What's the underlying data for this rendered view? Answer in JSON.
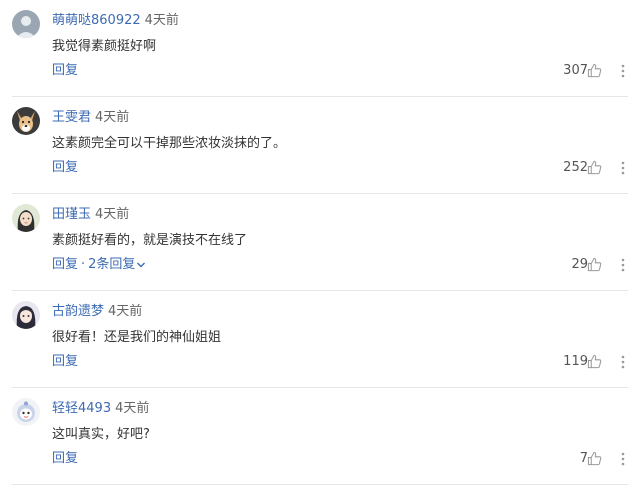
{
  "comments": [
    {
      "username": "萌萌哒860922",
      "time": "4天前",
      "text": "我觉得素颜挺好啊",
      "reply": "回复",
      "sub_replies": "",
      "likes": "307",
      "avatar_icon": "gray-avatar-icon"
    },
    {
      "username": "王雯君",
      "time": "4天前",
      "text": "这素颜完全可以干掉那些浓妆淡抹的了。",
      "reply": "回复",
      "sub_replies": "",
      "likes": "252",
      "avatar_icon": "dog-avatar-icon"
    },
    {
      "username": "田瑾玉",
      "time": "4天前",
      "text": "素颜挺好看的，就是演技不在线了",
      "reply": "回复",
      "sub_replies": "2条回复",
      "likes": "29",
      "avatar_icon": "girl-avatar-icon"
    },
    {
      "username": "古韵遗梦",
      "time": "4天前",
      "text": "很好看！还是我们的神仙姐姐",
      "reply": "回复",
      "sub_replies": "",
      "likes": "119",
      "avatar_icon": "anime-avatar-icon"
    },
    {
      "username": "轻轻4493",
      "time": "4天前",
      "text": "这叫真实，好吧?",
      "reply": "回复",
      "sub_replies": "",
      "likes": "7",
      "avatar_icon": "cartoon-avatar-icon"
    }
  ],
  "colors": {
    "link": "#3d6bb3",
    "text": "#333333",
    "meta": "#666666",
    "separator": "#e6e6e6"
  }
}
